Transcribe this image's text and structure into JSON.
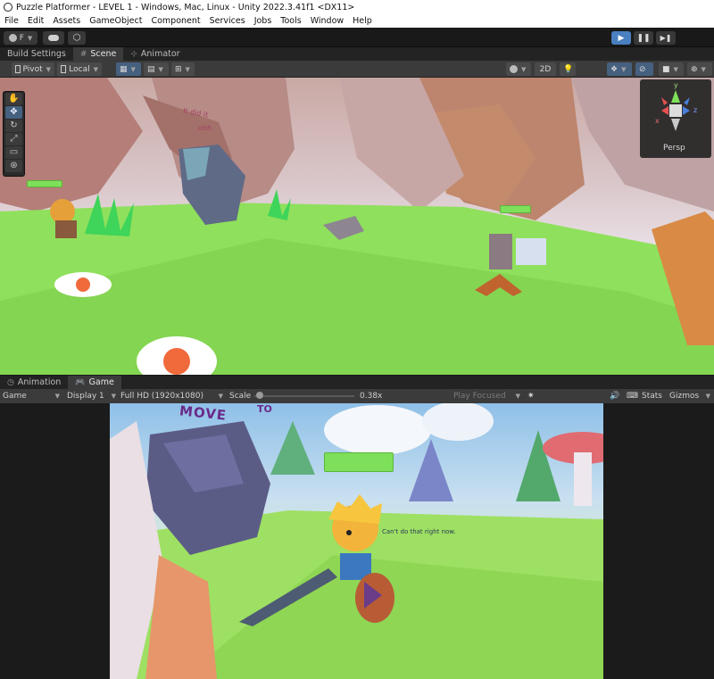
{
  "window": {
    "title": "Puzzle Platformer - LEVEL 1 - Windows, Mac, Linux - Unity 2022.3.41f1 <DX11>"
  },
  "menu": [
    "File",
    "Edit",
    "Assets",
    "GameObject",
    "Component",
    "Services",
    "Jobs",
    "Tools",
    "Window",
    "Help"
  ],
  "toolbar": {
    "account_label": "F",
    "play": {
      "active": true
    }
  },
  "upper_tabs": {
    "build_settings": "Build Settings",
    "scene": "Scene",
    "animator": "Animator"
  },
  "scene_toolbar": {
    "pivot_label": "Pivot",
    "local_label": "Local",
    "mode_2d": "2D"
  },
  "scene_gizmo": {
    "axis_y": "y",
    "axis_x": "x",
    "axis_z": "z",
    "projection_label": "Persp"
  },
  "scene_view": {
    "sign_text": "It did it",
    "sign_text_2": "ohh"
  },
  "lower_tabs": {
    "animation": "Animation",
    "game": "Game"
  },
  "game_toolbar": {
    "view_mode": "Game",
    "display": "Display 1",
    "resolution": "Full HD (1920x1080)",
    "scale_label": "Scale",
    "scale_value": "0.38x",
    "scale_fraction": 0.02,
    "play_focused": "Play Focused",
    "stats": "Stats",
    "gizmos": "Gizmos"
  },
  "game_view": {
    "move_text": "MOVE",
    "to_text": "TO",
    "hint_text": "Can't do that right now."
  },
  "colors": {
    "accent_play": "#4a7fc0",
    "grass": "#8fe05c",
    "health_bar": "#7ee05a"
  }
}
